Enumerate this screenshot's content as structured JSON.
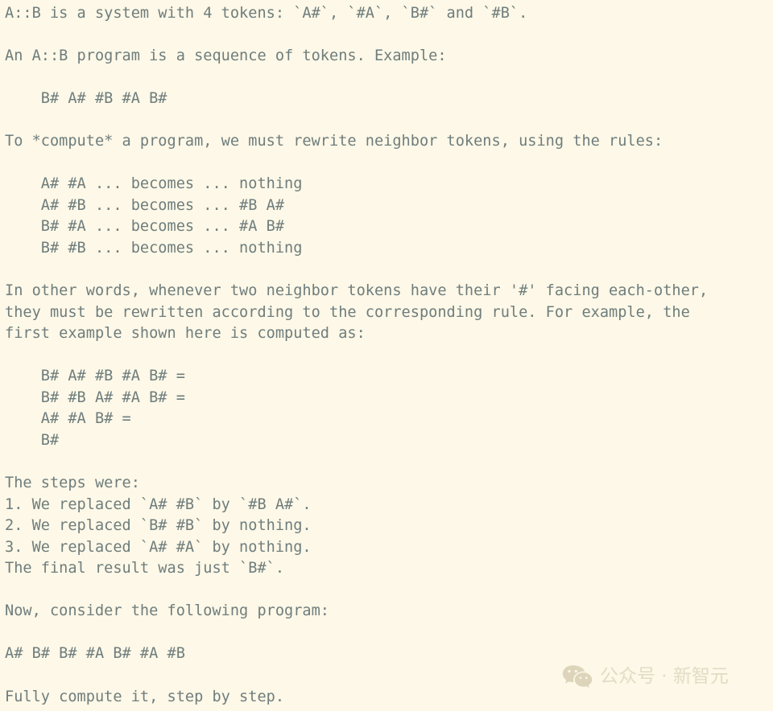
{
  "document": {
    "background_color": "#fdf8e7",
    "text_color": "#6f7d7d",
    "lines": [
      "A::B is a system with 4 tokens: `A#`, `#A`, `B#` and `#B`.",
      "",
      "An A::B program is a sequence of tokens. Example:",
      "",
      "    B# A# #B #A B#",
      "",
      "To *compute* a program, we must rewrite neighbor tokens, using the rules:",
      "",
      "    A# #A ... becomes ... nothing",
      "    A# #B ... becomes ... #B A#",
      "    B# #A ... becomes ... #A B#",
      "    B# #B ... becomes ... nothing",
      "",
      "In other words, whenever two neighbor tokens have their '#' facing each-other,",
      "they must be rewritten according to the corresponding rule. For example, the",
      "first example shown here is computed as:",
      "",
      "    B# A# #B #A B# =",
      "    B# #B A# #A B# =",
      "    A# #A B# =",
      "    B#",
      "",
      "The steps were:",
      "1. We replaced `A# #B` by `#B A#`.",
      "2. We replaced `B# #B` by nothing.",
      "3. We replaced `A# #A` by nothing.",
      "The final result was just `B#`.",
      "",
      "Now, consider the following program:",
      "",
      "A# B# B# #A B# #A #B",
      "",
      "Fully compute it, step by step."
    ]
  },
  "watermark": {
    "icon": "wechat-icon",
    "text": "公众号 · 新智元",
    "color": "#e3dcc4"
  }
}
